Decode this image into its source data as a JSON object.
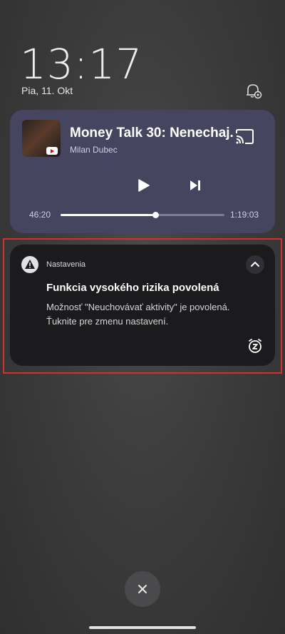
{
  "lockscreen": {
    "time": "13:17",
    "date": "Pia, 11. Okt"
  },
  "media": {
    "title": "Money Talk 30: Nenechaj...",
    "artist": "Milan Dubec",
    "elapsed": "46:20",
    "duration": "1:19:03",
    "progress": 0.58,
    "icons": {
      "cast": "cast-icon",
      "play": "play-icon",
      "next": "skip-next-icon",
      "source": "youtube-icon"
    }
  },
  "notification": {
    "app_name": "Nastavenia",
    "title": "Funkcia vysokého rizika povolená",
    "body": "Možnosť \"Neuchovávať aktivity\" je povolená. Ťuknite pre zmenu nastavení.",
    "highlight_color": "#d32f2f",
    "icons": {
      "app": "warning-icon",
      "collapse": "chevron-up-icon",
      "snooze": "snooze-alarm-icon"
    }
  },
  "dismiss": {
    "icon": "close-icon"
  }
}
